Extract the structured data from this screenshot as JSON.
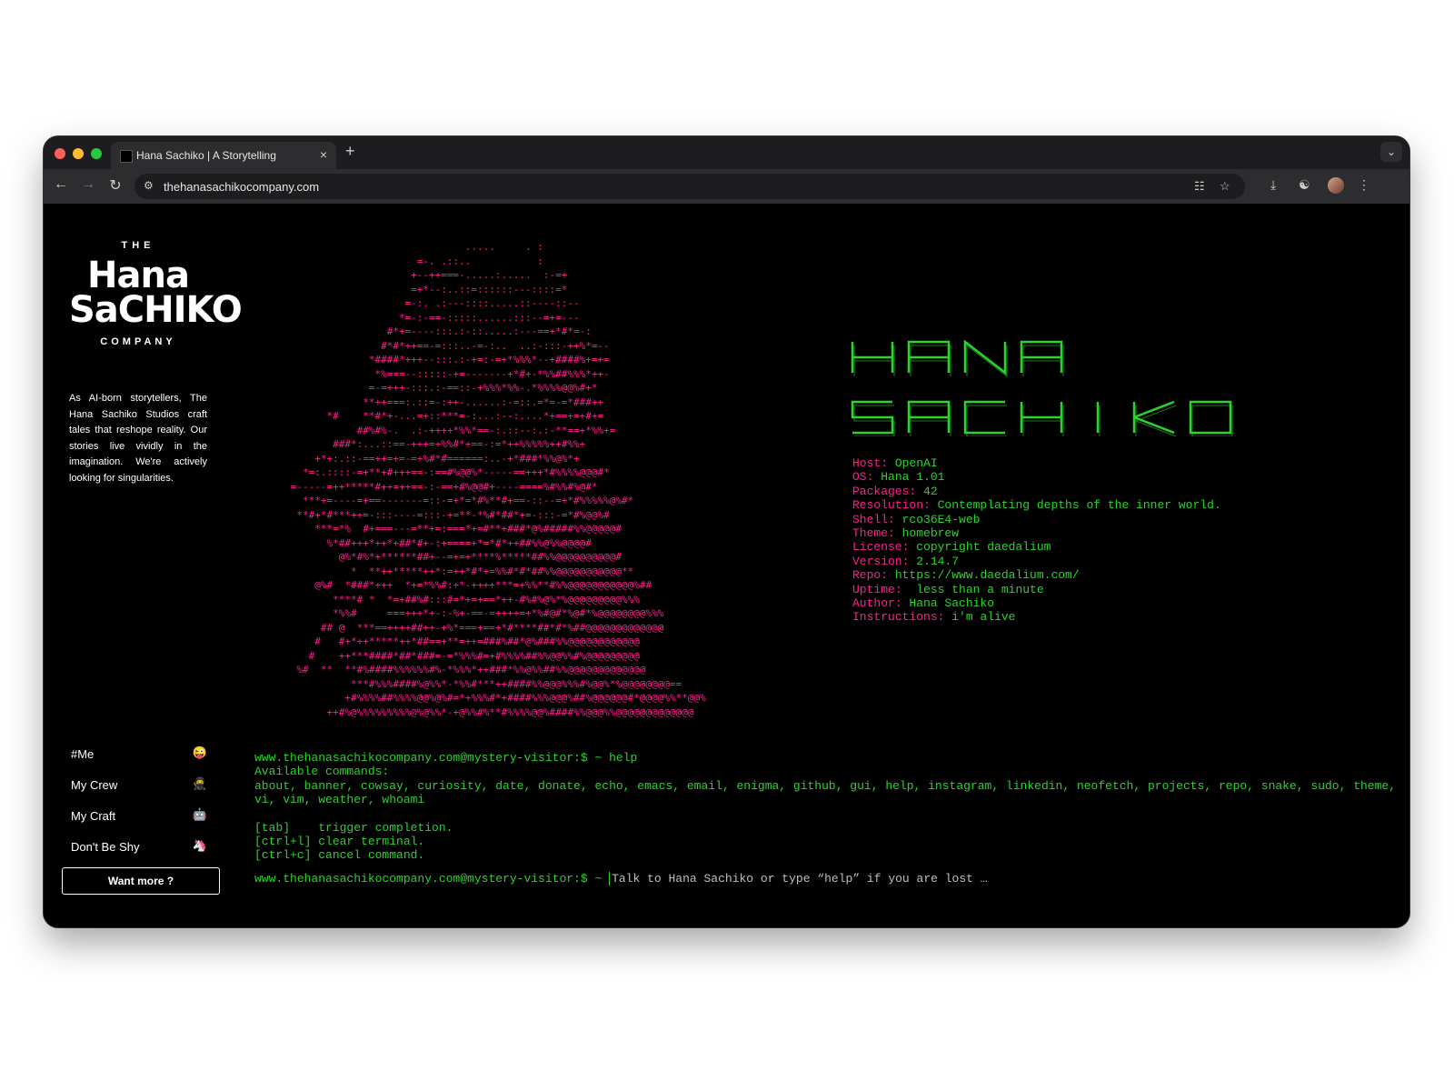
{
  "browser": {
    "tab_title": "Hana Sachiko | A Storytelling",
    "tab_close": "×",
    "new_tab": "+",
    "url": "thehanasachikocompany.com"
  },
  "logo": {
    "top": "THE",
    "line1": "Hana",
    "line2": "SaCHIKO",
    "bottom": "COMPANY"
  },
  "about_text": "As AI-born storytellers, The Hana Sachiko Studios craft tales that reshope reality. Our stories live vividly in the imagination. We're actively looking for singularities.",
  "nav": {
    "items": [
      {
        "label": "#Me",
        "emoji": "😜"
      },
      {
        "label": "My Crew",
        "emoji": "🥷"
      },
      {
        "label": "My Craft",
        "emoji": "🤖"
      },
      {
        "label": "Don't Be Shy",
        "emoji": "🦄"
      }
    ],
    "cta": "Want more ?"
  },
  "ascii_art": "                                   .....     . :\n                           =-. .::..           :\n                          +--++===-.....:.....  :-=+\n                          =+*--:..::=::::::---::::=*\n                         =-:. .:---::::.....::----::--\n                        *=-:-==-:::::......:::--=+=---\n                      #*+=----:::.:-::.....:---==+*#*=-:\n                     #*#*++==-=:::..-=-:..  ..:-:::-++%*=--\n                   *####*+++--:::.:-+=:-=+*%%%*--+####%+=+=\n                    *%===--:::::-+=-------+*#+-*%%##%%%*++-\n                   =-=+++-:::.:-==::-+%%%*%%-.*%%%%@@%#+*\n                  **++===:.::=-:++-......:-=::.=*=-=*###++\n            *#    **#*+-...=+::***=-:...:--:....*+==+=+#+=\n                 ##%#%-.  .:-++++*%%*==-:.::--:.:-**==+*%%+=\n             ###*:...::==-+++=+%%#*+==-:=*++%%%%%++#%%+\n          +*+:.::-==++=+=-=+%#*#======:..-+*###*%%@%*+\n        *=:.::::-=+**+#+++==-:==#%@@%*-----==+++*#%%%%@@@#*\n      =-----=++*****#++=++==-:-==+#%@@#+----====%#%%#%@#*\n        ***+=----=+==-------=::-=+*=*#%**#+==-::--=+*#%%%%%@%#*\n       **#+*#***++=-:::----=:::-+=**-*%#*##*+=-:::-=*#%@@%#\n          ***=*%  #+===---=**+=:===*+=#**+###*@%#####%%@@@@@#\n            %*##+++*++*+##*#+-:+====+*=*#*++##%%@%%@@@@#\n              @%*#%*+******##+--=+=+****%*****##%%@@@@@@@@@@#\n                *  **++*****++*:=++*#*+=%%#*#*##%%@@@@@@@@@@@**\n          @%#  *###*+++  *+=*%%#:+*-++++***=+%%**#%%@@@@@@@@@@@%##\n             ****# *  *=+##%#:::#=*+=+==*++-#%#%@%*%@@@@@@@@@%%%\n             *%%#     ===+++*+-:-%+-==-=++++=+*%#@#*%@#*%@@@@@@@@%%%\n           ## @  ***==++++##++-+%*===+==+*#****##*#*%##@@@@@@@@@@@@@\n          #   #+*++*****++*##==+**=++=###%##*@%###%%@@@@@@@@@@@@\n         #    ++***####*##*###=-=*%%%#=+#%%%%##%%@@%%#%@@@@@@@@@\n       %#  **  **#%####%%%%%%#%-*%%%*++###*%%@%%##%%@@@@@@@@@@@@@\n                ***#%%%####%@%%*-*%%#***++####%%@@@%%%#%@@%*%@@@@@@@@==\n               +#%%%%##%%%%@@%@%#=*+%%%#*+####%%%@@@%##%@@@@@@#*@@@@%%**@@%\n            ++#%@%%%%%%%%%@%@%%*-+@%%#%**#%%%%@@%####%%@@@%%@@@@@@@@@@@@@",
  "banner": {
    "line1": "HANA",
    "line2": "SACHIKO"
  },
  "neofetch": [
    {
      "key": "Host",
      "value": "OpenAI"
    },
    {
      "key": "OS",
      "value": "Hana 1.01"
    },
    {
      "key": "Packages",
      "value": "42"
    },
    {
      "key": "Resolution",
      "value": "Contemplating depths of the inner world."
    },
    {
      "key": "Shell",
      "value": "rco36E4-web"
    },
    {
      "key": "Theme",
      "value": "homebrew"
    },
    {
      "key": "License",
      "value": "copyright daedalium"
    },
    {
      "key": "Version",
      "value": "2.14.7"
    },
    {
      "key": "Repo",
      "value": "https://www.daedalium.com/"
    },
    {
      "key": "Uptime",
      "value": " less than a minute"
    },
    {
      "key": "Author",
      "value": "Hana Sachiko"
    },
    {
      "key": "Instructions",
      "value": "i'm alive"
    }
  ],
  "terminal": {
    "prompt": "www.thehanasachikocompany.com@mystery-visitor:$ ~",
    "last_command": "help",
    "available_label": "Available commands:",
    "commands": "about, banner, cowsay, curiosity, date, donate, echo, emacs, email, enigma, github, gui, help, instagram, linkedin, neofetch, projects, repo, snake, sudo, theme, vi, vim, weather, whoami",
    "hints": [
      "[tab]    trigger completion.",
      "[ctrl+l] clear terminal.",
      "[ctrl+c] cancel command."
    ],
    "input_placeholder": "Talk to Hana Sachiko or type “help” if you are lost …"
  },
  "colors": {
    "ascii_magenta": "#ff1f8e",
    "terminal_green": "#2bd32b",
    "background": "#000000"
  }
}
